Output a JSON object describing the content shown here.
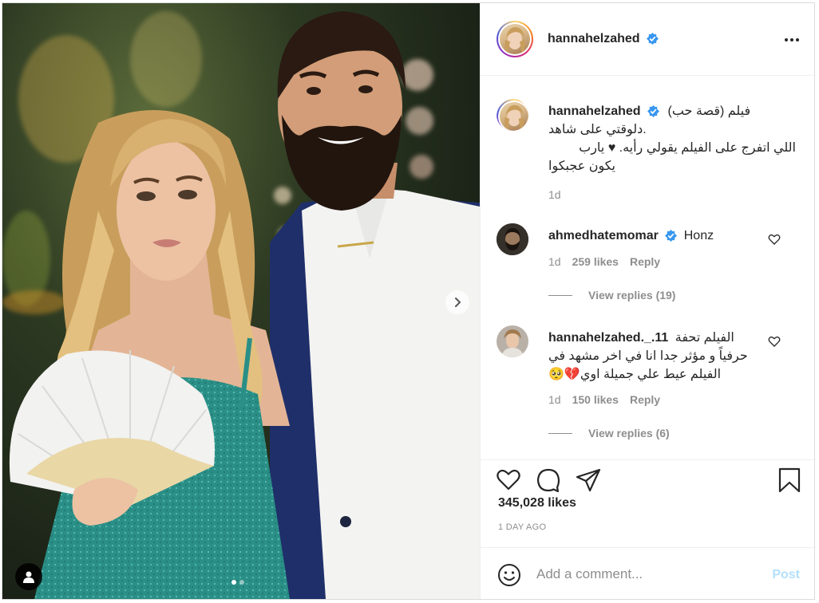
{
  "post": {
    "username": "hannahelzahed",
    "more_label": "More options"
  },
  "caption": {
    "username": "hannahelzahed",
    "text_line1": "فيلم (قصة حب)",
    "text_line2": "دلوقتي على شاهد.",
    "text_line3": "اللي اتفرج على الفيلم يقولي رأيه. ♥ يارب",
    "text_line4": "يكون عجبكوا",
    "time": "1d"
  },
  "comments": [
    {
      "username": "ahmedhatemomar",
      "verified": true,
      "text": "Honz",
      "time": "1d",
      "likes": "259 likes",
      "reply_label": "Reply",
      "view_replies": "View replies (19)"
    },
    {
      "username": "hannahelzahed._.11",
      "verified": false,
      "text_line1": "الفيلم تحفة",
      "text_line2": "حرفياً و مؤثر جدا انا في اخر مشهد في",
      "text_line3": "الفيلم عيط علي جميلة اوي",
      "emoji": "🥺💔",
      "time": "1d",
      "likes": "150 likes",
      "reply_label": "Reply",
      "view_replies": "View replies (6)"
    }
  ],
  "engagement": {
    "likes": "345,028 likes",
    "posted": "1 DAY AGO"
  },
  "composer": {
    "placeholder": "Add a comment...",
    "post_label": "Post"
  },
  "icons": {
    "verified": "verified-badge-icon",
    "heart": "heart-icon",
    "comment": "comment-icon",
    "share": "share-icon",
    "save": "bookmark-icon",
    "emoji": "emoji-icon",
    "next": "chevron-right-icon",
    "user_tag": "user-icon"
  },
  "colors": {
    "verified": "#3897f0",
    "post_disabled": "#b2dffc",
    "muted": "#8e8e8e"
  },
  "carousel": {
    "total": 2,
    "current": 1
  }
}
